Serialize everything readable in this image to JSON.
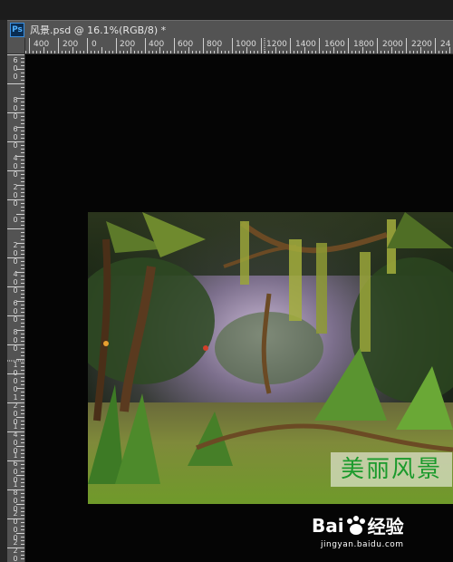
{
  "document": {
    "app_icon_label": "Ps",
    "title": "风景.psd @ 16.1%(RGB/8) *"
  },
  "rulers": {
    "top_labels": [
      "400",
      "200",
      "0",
      "200",
      "400",
      "600",
      "800",
      "1000",
      "1200",
      "1400",
      "1600",
      "1800",
      "2000",
      "2200",
      "24"
    ],
    "left_labels": [
      "6\n0\n0",
      "8\n0\n0",
      "6\n0\n0",
      "4\n0\n0",
      "2\n0\n0",
      "0",
      "2\n0\n0",
      "4\n0\n0",
      "6\n0\n0",
      "8\n0\n0",
      "1\n0\n0\n0",
      "1\n2\n0\n0",
      "1\n4\n0\n0",
      "1\n6\n0\n0",
      "1\n8\n0\n0",
      "2\n0\n0\n0",
      "2\n2\n0\n0"
    ]
  },
  "image": {
    "overlay_text": "美丽风景",
    "overlay_text_color": "#1b9a2c"
  },
  "watermark": {
    "brand_prefix": "Bai",
    "brand_suffix": "经验",
    "domain": "jingyan.baidu.com"
  },
  "colors": {
    "panel": "#535353",
    "canvas": "#050505"
  }
}
